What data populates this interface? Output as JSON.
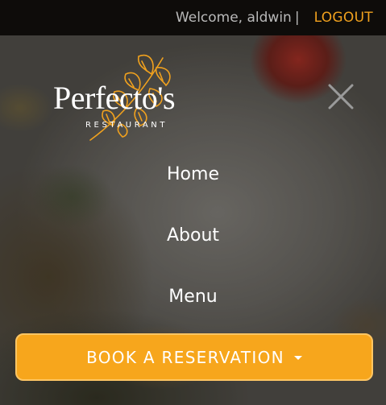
{
  "header": {
    "welcome_text": "Welcome, aldwin",
    "separator": "|",
    "logout_label": "LOGOUT"
  },
  "logo": {
    "name": "Perfecto's",
    "subtitle": "RESTAURANT"
  },
  "nav": {
    "items": [
      {
        "label": "Home"
      },
      {
        "label": "About"
      },
      {
        "label": "Menu"
      }
    ]
  },
  "reservation": {
    "label": "BOOK A RESERVATION"
  },
  "icons": {
    "close": "close-icon",
    "dropdown": "caret-down-icon",
    "logo_leaf": "leaf-branch-icon"
  },
  "colors": {
    "accent": "#f7a61c",
    "logout": "#f0a11e",
    "topbar_bg": "#0e0c0a"
  }
}
